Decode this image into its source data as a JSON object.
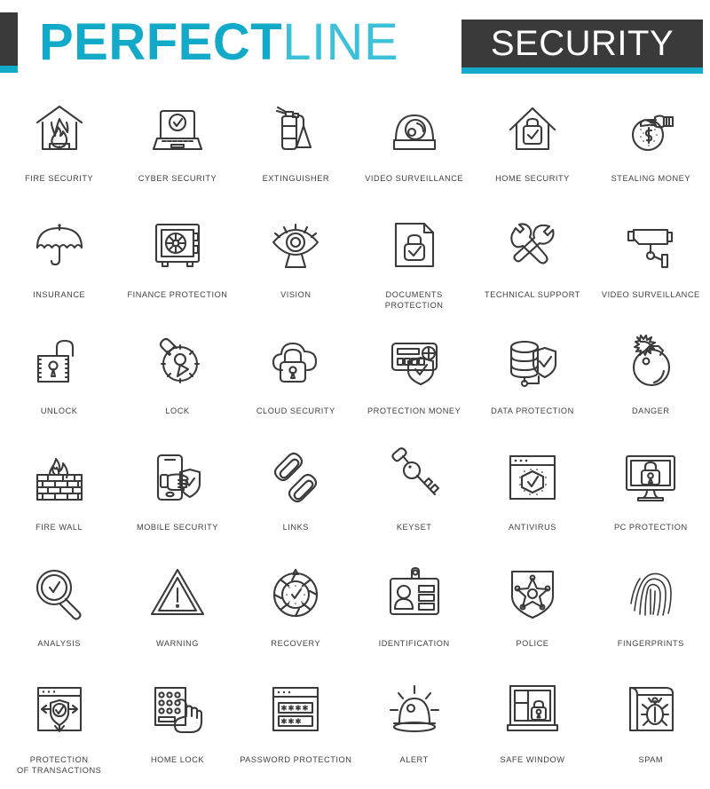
{
  "header": {
    "brand_bold": "PERFECT",
    "brand_light": "LINE",
    "category": "SECURITY",
    "accent_color": "#12aac8",
    "dark_color": "#3a3a3a"
  },
  "icons": [
    {
      "label": "FIRE SECURITY",
      "name": "fire-security-icon"
    },
    {
      "label": "CYBER SECURITY",
      "name": "cyber-security-icon"
    },
    {
      "label": "EXTINGUISHER",
      "name": "extinguisher-icon"
    },
    {
      "label": "VIDEO SURVEILLANCE",
      "name": "video-surveillance-dome-icon"
    },
    {
      "label": "HOME SECURITY",
      "name": "home-security-icon"
    },
    {
      "label": "STEALING MONEY",
      "name": "stealing-money-icon"
    },
    {
      "label": "INSURANCE",
      "name": "insurance-umbrella-icon"
    },
    {
      "label": "FINANCE PROTECTION",
      "name": "finance-protection-safe-icon"
    },
    {
      "label": "VISION",
      "name": "vision-eye-icon"
    },
    {
      "label": "DOCUMENTS PROTECTION",
      "name": "documents-protection-icon"
    },
    {
      "label": "TECHNICAL SUPPORT",
      "name": "technical-support-icon"
    },
    {
      "label": "VIDEO SURVEILLANCE",
      "name": "video-surveillance-camera-icon"
    },
    {
      "label": "UNLOCK",
      "name": "unlock-icon"
    },
    {
      "label": "LOCK",
      "name": "lock-icon"
    },
    {
      "label": "CLOUD SECURITY",
      "name": "cloud-security-icon"
    },
    {
      "label": "PROTECTION MONEY",
      "name": "protection-money-icon"
    },
    {
      "label": "DATA PROTECTION",
      "name": "data-protection-icon"
    },
    {
      "label": "DANGER",
      "name": "danger-bomb-icon"
    },
    {
      "label": "FIRE WALL",
      "name": "fire-wall-icon"
    },
    {
      "label": "MOBILE SECURITY",
      "name": "mobile-security-icon"
    },
    {
      "label": "LINKS",
      "name": "links-chain-icon"
    },
    {
      "label": "KEYSET",
      "name": "keyset-icon"
    },
    {
      "label": "ANTIVIRUS",
      "name": "antivirus-icon"
    },
    {
      "label": "PC PROTECTION",
      "name": "pc-protection-icon"
    },
    {
      "label": "ANALYSIS",
      "name": "analysis-magnifier-icon"
    },
    {
      "label": "WARNING",
      "name": "warning-triangle-icon"
    },
    {
      "label": "RECOVERY",
      "name": "recovery-icon"
    },
    {
      "label": "IDENTIFICATION",
      "name": "identification-badge-icon"
    },
    {
      "label": "POLICE",
      "name": "police-shield-icon"
    },
    {
      "label": "FINGERPRINTS",
      "name": "fingerprints-icon"
    },
    {
      "label": "PROTECTION\nOF TRANSACTIONS",
      "name": "protection-of-transactions-icon"
    },
    {
      "label": "HOME LOCK",
      "name": "home-lock-keypad-icon"
    },
    {
      "label": "PASSWORD PROTECTION",
      "name": "password-protection-icon"
    },
    {
      "label": "ALERT",
      "name": "alert-siren-icon"
    },
    {
      "label": "SAFE WINDOW",
      "name": "safe-window-icon"
    },
    {
      "label": "SPAM",
      "name": "spam-bug-icon"
    }
  ]
}
